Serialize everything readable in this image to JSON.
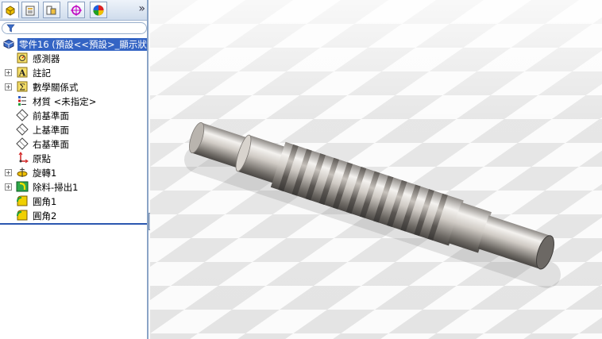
{
  "feature_tree": {
    "root_label": "零件16 (預設<<預設>_顯示狀態",
    "items": [
      {
        "label": "感測器",
        "icon": "sensor-icon",
        "expandable": false
      },
      {
        "label": "註記",
        "icon": "annotation-icon",
        "expandable": true
      },
      {
        "label": "數學關係式",
        "icon": "equation-icon",
        "expandable": true
      },
      {
        "label": "材質 <未指定>",
        "icon": "material-icon",
        "expandable": false
      },
      {
        "label": "前基準面",
        "icon": "plane-icon",
        "expandable": false
      },
      {
        "label": "上基準面",
        "icon": "plane-icon",
        "expandable": false
      },
      {
        "label": "右基準面",
        "icon": "plane-icon",
        "expandable": false
      },
      {
        "label": "原點",
        "icon": "origin-icon",
        "expandable": false
      },
      {
        "label": "旋轉1",
        "icon": "revolve-icon",
        "expandable": true
      },
      {
        "label": "除料-掃出1",
        "icon": "sweep-cut-icon",
        "expandable": true
      },
      {
        "label": "圓角1",
        "icon": "fillet-icon",
        "expandable": false
      },
      {
        "label": "圓角2",
        "icon": "fillet-icon",
        "expandable": false
      }
    ]
  },
  "tabs": [
    {
      "name": "feature-manager-tab",
      "icon": "feature-manager-icon"
    },
    {
      "name": "property-manager-tab",
      "icon": "property-manager-icon"
    },
    {
      "name": "configuration-manager-tab",
      "icon": "configuration-manager-icon"
    },
    {
      "name": "dimxpert-manager-tab",
      "icon": "dimxpert-icon"
    },
    {
      "name": "display-manager-tab",
      "icon": "display-manager-icon"
    }
  ],
  "toolbar": {
    "more_label": "»"
  },
  "colors": {
    "selection": "#3464c4",
    "panel_border": "#8aa4c6",
    "part_metal": "#c9c4be"
  }
}
